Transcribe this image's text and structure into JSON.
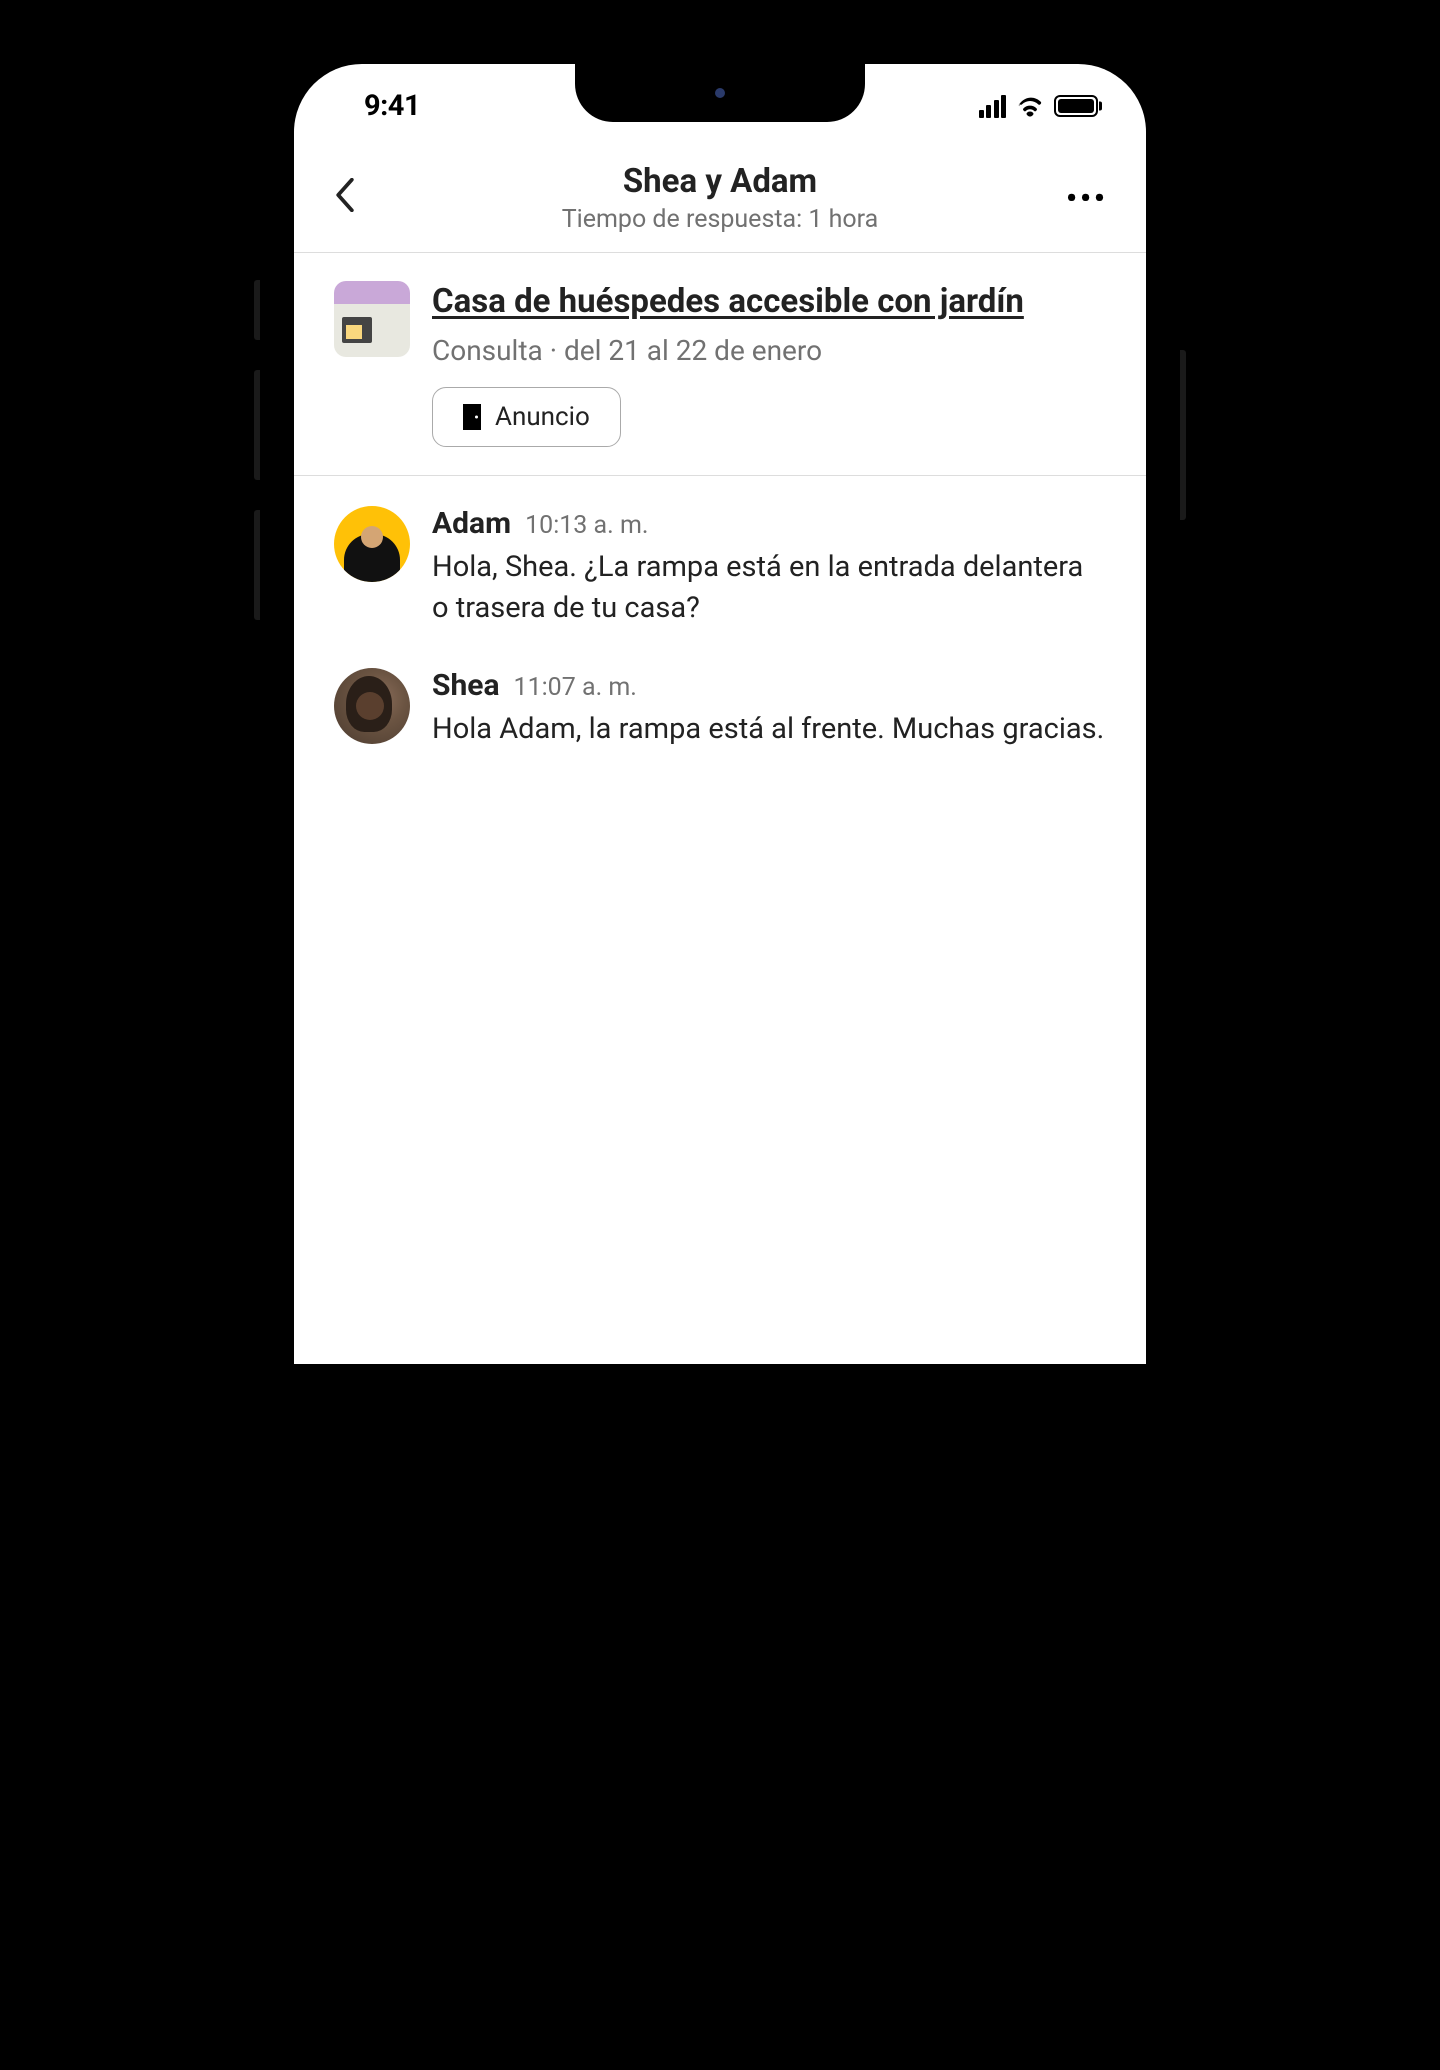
{
  "status": {
    "time": "9:41"
  },
  "header": {
    "title": "Shea y Adam",
    "subtitle": "Tiempo de respuesta: 1 hora"
  },
  "listing": {
    "title": "Casa de huéspedes accesible con jardín",
    "subtitle": "Consulta · del 21 al 22 de enero",
    "pill_label": "Anuncio"
  },
  "messages": [
    {
      "sender": "Adam",
      "time": "10:13 a. m.",
      "text": "Hola, Shea. ¿La rampa está en la entrada delantera o trasera de tu casa?",
      "avatar_class": "adam"
    },
    {
      "sender": "Shea",
      "time": "11:07 a. m.",
      "text": "Hola Adam, la rampa está al frente. Muchas gracias.",
      "avatar_class": "shea"
    }
  ]
}
